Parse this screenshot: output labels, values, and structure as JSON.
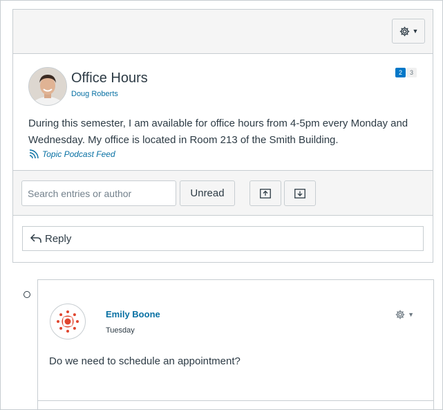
{
  "topic": {
    "title": "Office Hours",
    "author": "Doug Roberts",
    "unread_count": "2",
    "total_count": "3",
    "body": "During this semester, I am available for office hours from 4-5pm every Monday and Wednesday. My office is located in Room 213 of the Smith Building.",
    "podcast_link": "Topic Podcast Feed"
  },
  "toolbar": {
    "search_placeholder": "Search entries or author",
    "unread_label": "Unread"
  },
  "reply": {
    "label": "Reply"
  },
  "entries": [
    {
      "author": "Emily Boone",
      "date": "Tuesday",
      "body": "Do we need to schedule an appointment?"
    }
  ],
  "colors": {
    "link": "#0770a3",
    "badge_blue": "#0077c8",
    "canvas_red": "#e0452e",
    "header_bg": "#f5f5f5",
    "border": "#c7cdd1"
  },
  "icons": [
    "settings-gear-icon",
    "rss-icon",
    "collapse-all-icon",
    "expand-all-icon",
    "reply-arrow-icon",
    "canvas-logo-icon"
  ]
}
